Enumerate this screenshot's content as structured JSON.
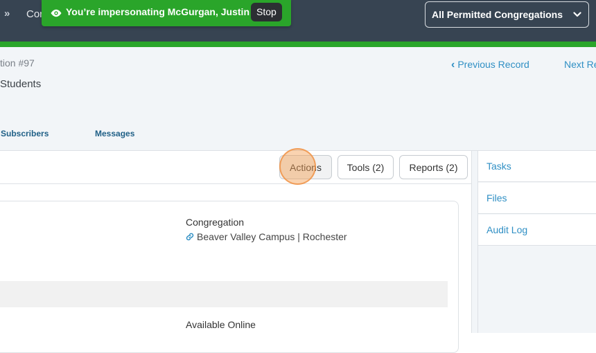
{
  "topbar": {
    "chevrons": "»",
    "crumb": "Cor",
    "impersonation_text": "You’re impersonating McGurgan, Justin",
    "stop_label": "Stop",
    "congregation_select": "All Permitted Congregations",
    "accent_color": "#2aa52a"
  },
  "header": {
    "record_id": "tion #97",
    "record_title": "Students",
    "previous_label": "Previous Record",
    "next_label": "Next Re",
    "tabs": [
      {
        "label": "Subscribers"
      },
      {
        "label": "Messages"
      }
    ]
  },
  "toolbar": {
    "actions_label": "Actions",
    "tools_label": "Tools (2)",
    "reports_label": "Reports (2)"
  },
  "details": {
    "congregation_label": "Congregation",
    "congregation_value": "Beaver Valley Campus | Rochester",
    "available_online_label": "Available Online"
  },
  "sidebar": {
    "items": [
      {
        "label": "Tasks"
      },
      {
        "label": "Files"
      },
      {
        "label": "Audit Log"
      }
    ]
  }
}
